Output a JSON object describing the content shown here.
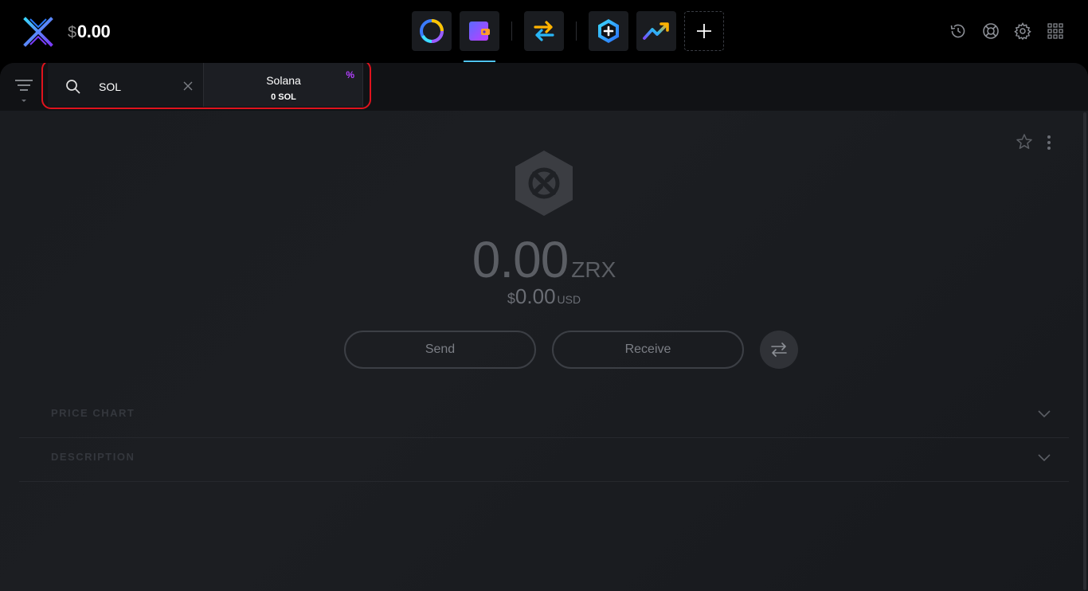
{
  "header": {
    "balance_symbol": "$",
    "balance_value": "0.00",
    "apps": [
      {
        "name": "portfolio-app-icon"
      },
      {
        "name": "wallet-app-icon",
        "active": true
      },
      {
        "name": "exchange-app-icon"
      },
      {
        "name": "add-app-icon"
      },
      {
        "name": "trending-app-icon"
      },
      {
        "name": "add-new-app-icon"
      }
    ],
    "right_icons": [
      "history-icon",
      "support-icon",
      "settings-icon",
      "apps-grid-icon"
    ]
  },
  "search": {
    "value": "SOL",
    "placeholder": ""
  },
  "asset_tile": {
    "name": "Solana",
    "amount": "0 SOL",
    "badge": "%"
  },
  "asset": {
    "balance": "0.00",
    "ticker": "ZRX",
    "usd_symbol": "$",
    "usd_value": "0.00",
    "usd_unit": "USD"
  },
  "actions": {
    "send_label": "Send",
    "receive_label": "Receive"
  },
  "sections": {
    "price_chart": "PRICE CHART",
    "description": "DESCRIPTION"
  },
  "colors": {
    "accent": "#4fc3f7",
    "highlight": "#e0131d",
    "badge": "#b340ff"
  }
}
